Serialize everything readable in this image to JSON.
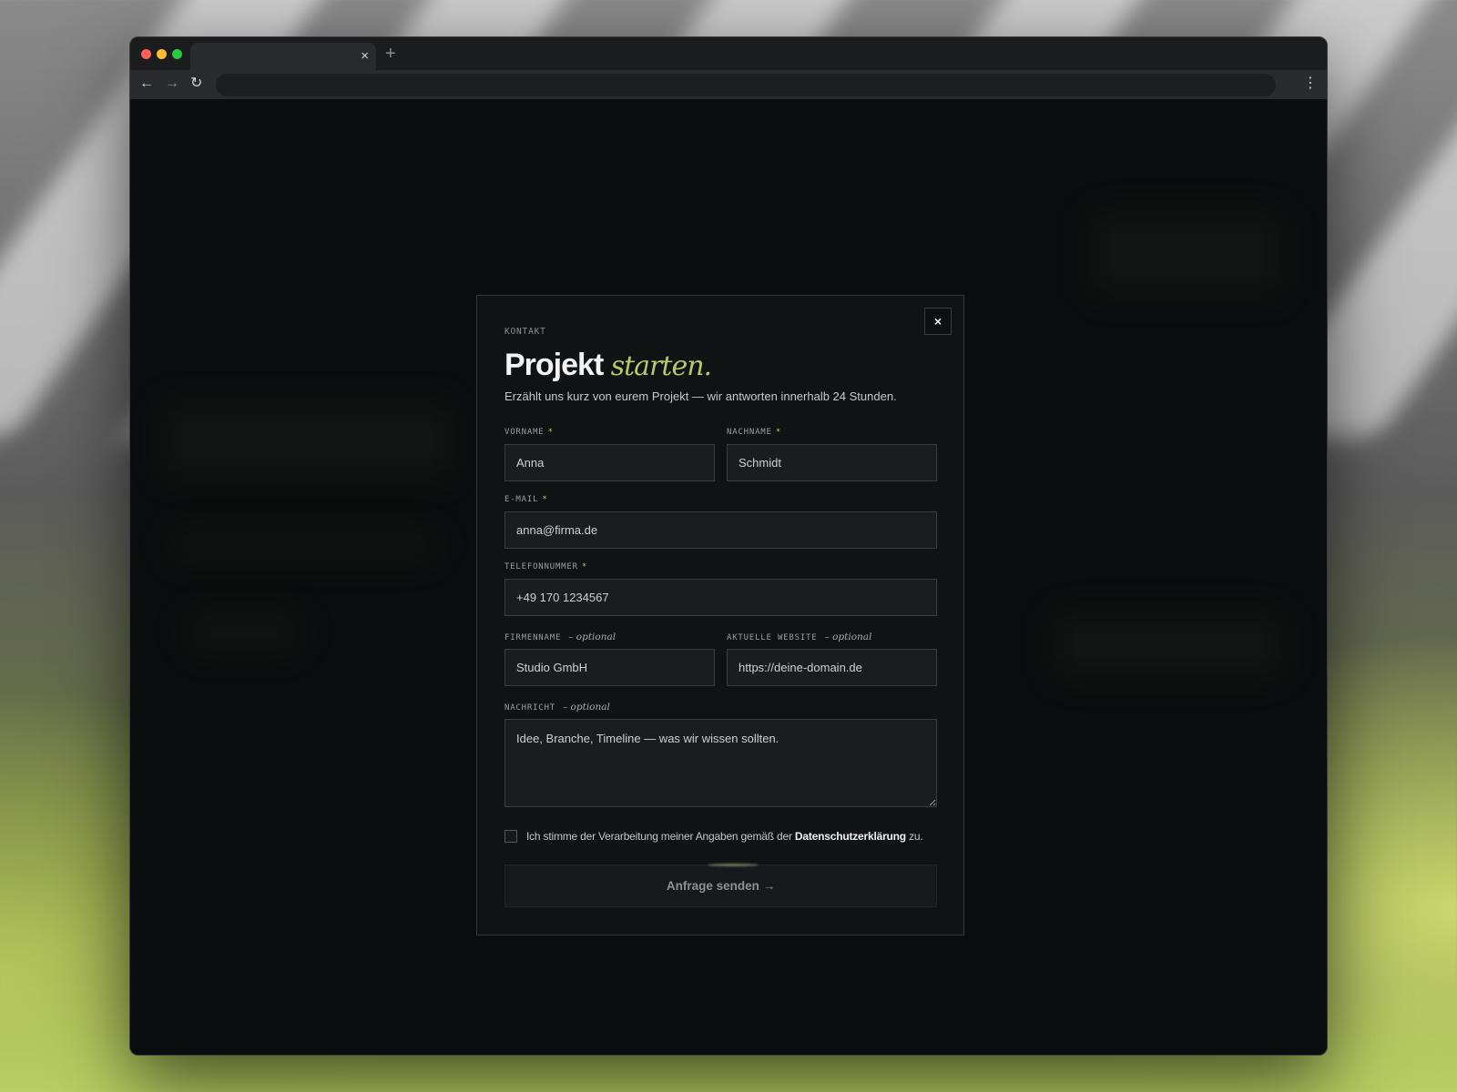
{
  "browser": {
    "tab_close": "×",
    "new_tab": "+",
    "back": "←",
    "forward": "→",
    "reload": "↻",
    "menu": "⋮",
    "address": ""
  },
  "modal": {
    "close": "×",
    "eyebrow": "KONTAKT",
    "title_main": "Projekt",
    "title_accent": "starten.",
    "subtitle": "Erzählt uns kurz von eurem Projekt — wir antworten innerhalb 24 Stunden."
  },
  "form": {
    "required_marker": "*",
    "optional_marker": "– optional",
    "vorname": {
      "label": "VORNAME",
      "value": "",
      "placeholder": "Anna"
    },
    "nachname": {
      "label": "NACHNAME",
      "value": "",
      "placeholder": "Schmidt"
    },
    "email": {
      "label": "E-MAIL",
      "value": "",
      "placeholder": "anna@firma.de"
    },
    "telefon": {
      "label": "TELEFONNUMMER",
      "value": "",
      "placeholder": "+49 170 1234567"
    },
    "firma": {
      "label": "FIRMENNAME",
      "value": "",
      "placeholder": "Studio GmbH"
    },
    "website": {
      "label": "AKTUELLE WEBSITE",
      "value": "",
      "placeholder": "https://deine-domain.de"
    },
    "nachricht": {
      "label": "NACHRICHT",
      "value": "",
      "placeholder": "Idee, Branche, Timeline — was wir wissen sollten."
    },
    "consent": {
      "checked": false,
      "text_before": "Ich stimme der Verarbeitung meiner Angaben gemäß der ",
      "link": "Datenschutzerklärung",
      "text_after": " zu."
    },
    "submit_label": "Anfrage senden →"
  }
}
